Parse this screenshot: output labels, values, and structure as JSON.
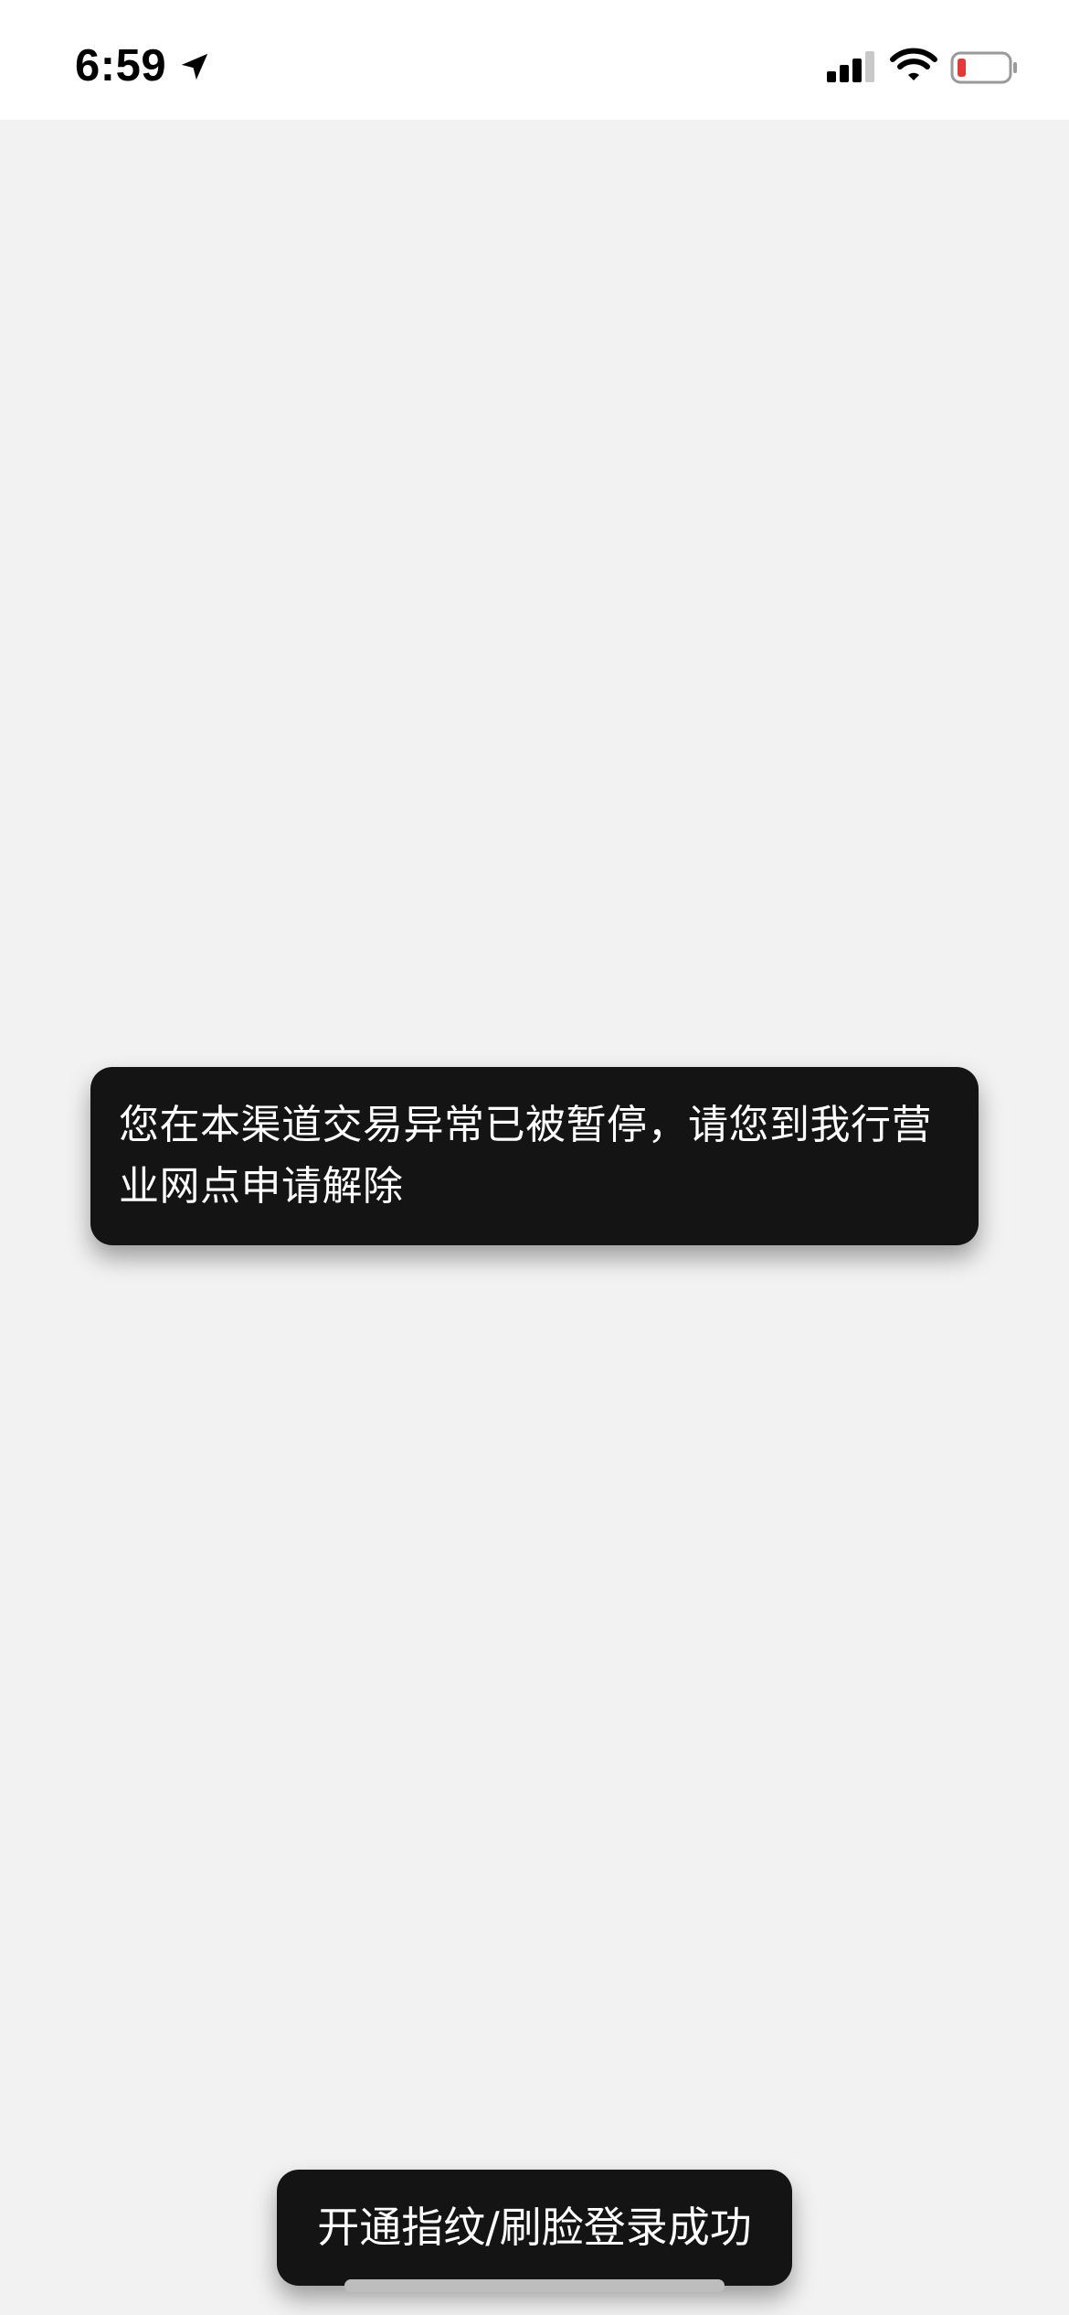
{
  "status_bar": {
    "time": "6:59",
    "icons": {
      "location": "location-arrow-icon",
      "signal": "cellular-signal-icon",
      "wifi": "wifi-icon",
      "battery": "battery-low-icon"
    },
    "battery_color": "#e5383b"
  },
  "toasts": {
    "main_message": "您在本渠道交易异常已被暂停，请您到我行营业网点申请解除",
    "bottom_message": "开通指纹/刷脸登录成功"
  },
  "colors": {
    "background": "#f2f2f2",
    "toast_background": "#141414",
    "toast_text": "#ffffff"
  }
}
